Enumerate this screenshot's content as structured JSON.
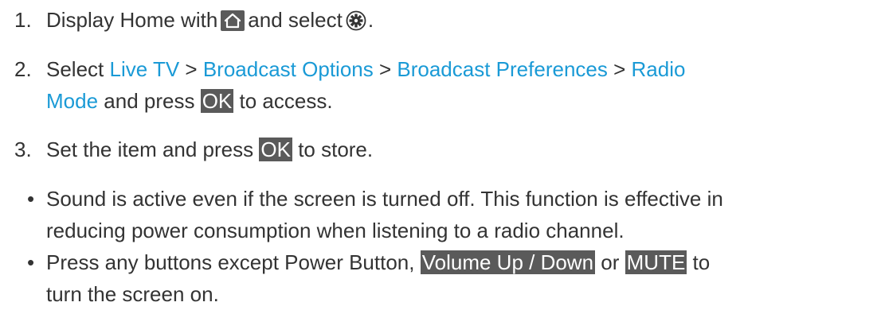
{
  "steps": [
    {
      "number": "1.",
      "text_before": "Display Home with",
      "text_middle": "and select",
      "text_end": ".",
      "icons": [
        "home-icon",
        "gear-icon"
      ]
    },
    {
      "number": "2.",
      "select": "Select",
      "links": [
        "Live TV",
        "Broadcast Options",
        "Broadcast Preferences",
        "Radio",
        "Mode"
      ],
      "separator": ">",
      "and_press": "and press",
      "key": "OK",
      "after_key": "to access."
    },
    {
      "number": "3.",
      "text_before": "Set the item and press",
      "key": "OK",
      "text_after": "to store."
    }
  ],
  "bullets": [
    {
      "marker": "•",
      "line1": "Sound is active even if the screen is turned off. This function is effective in",
      "line2": "reducing power consumption when listening to a radio channel."
    },
    {
      "marker": "•",
      "line1_before": "Press any buttons except Power Button,",
      "key1": "Volume Up / Down",
      "or": "or",
      "key2": "MUTE",
      "line1_after": "to",
      "line2": "turn the screen on."
    }
  ],
  "colors": {
    "text": "#333333",
    "link": "#1a9ad6",
    "key_bg": "#5a5a5a",
    "key_text": "#ffffff",
    "icon_bg": "#5a5a5a"
  }
}
